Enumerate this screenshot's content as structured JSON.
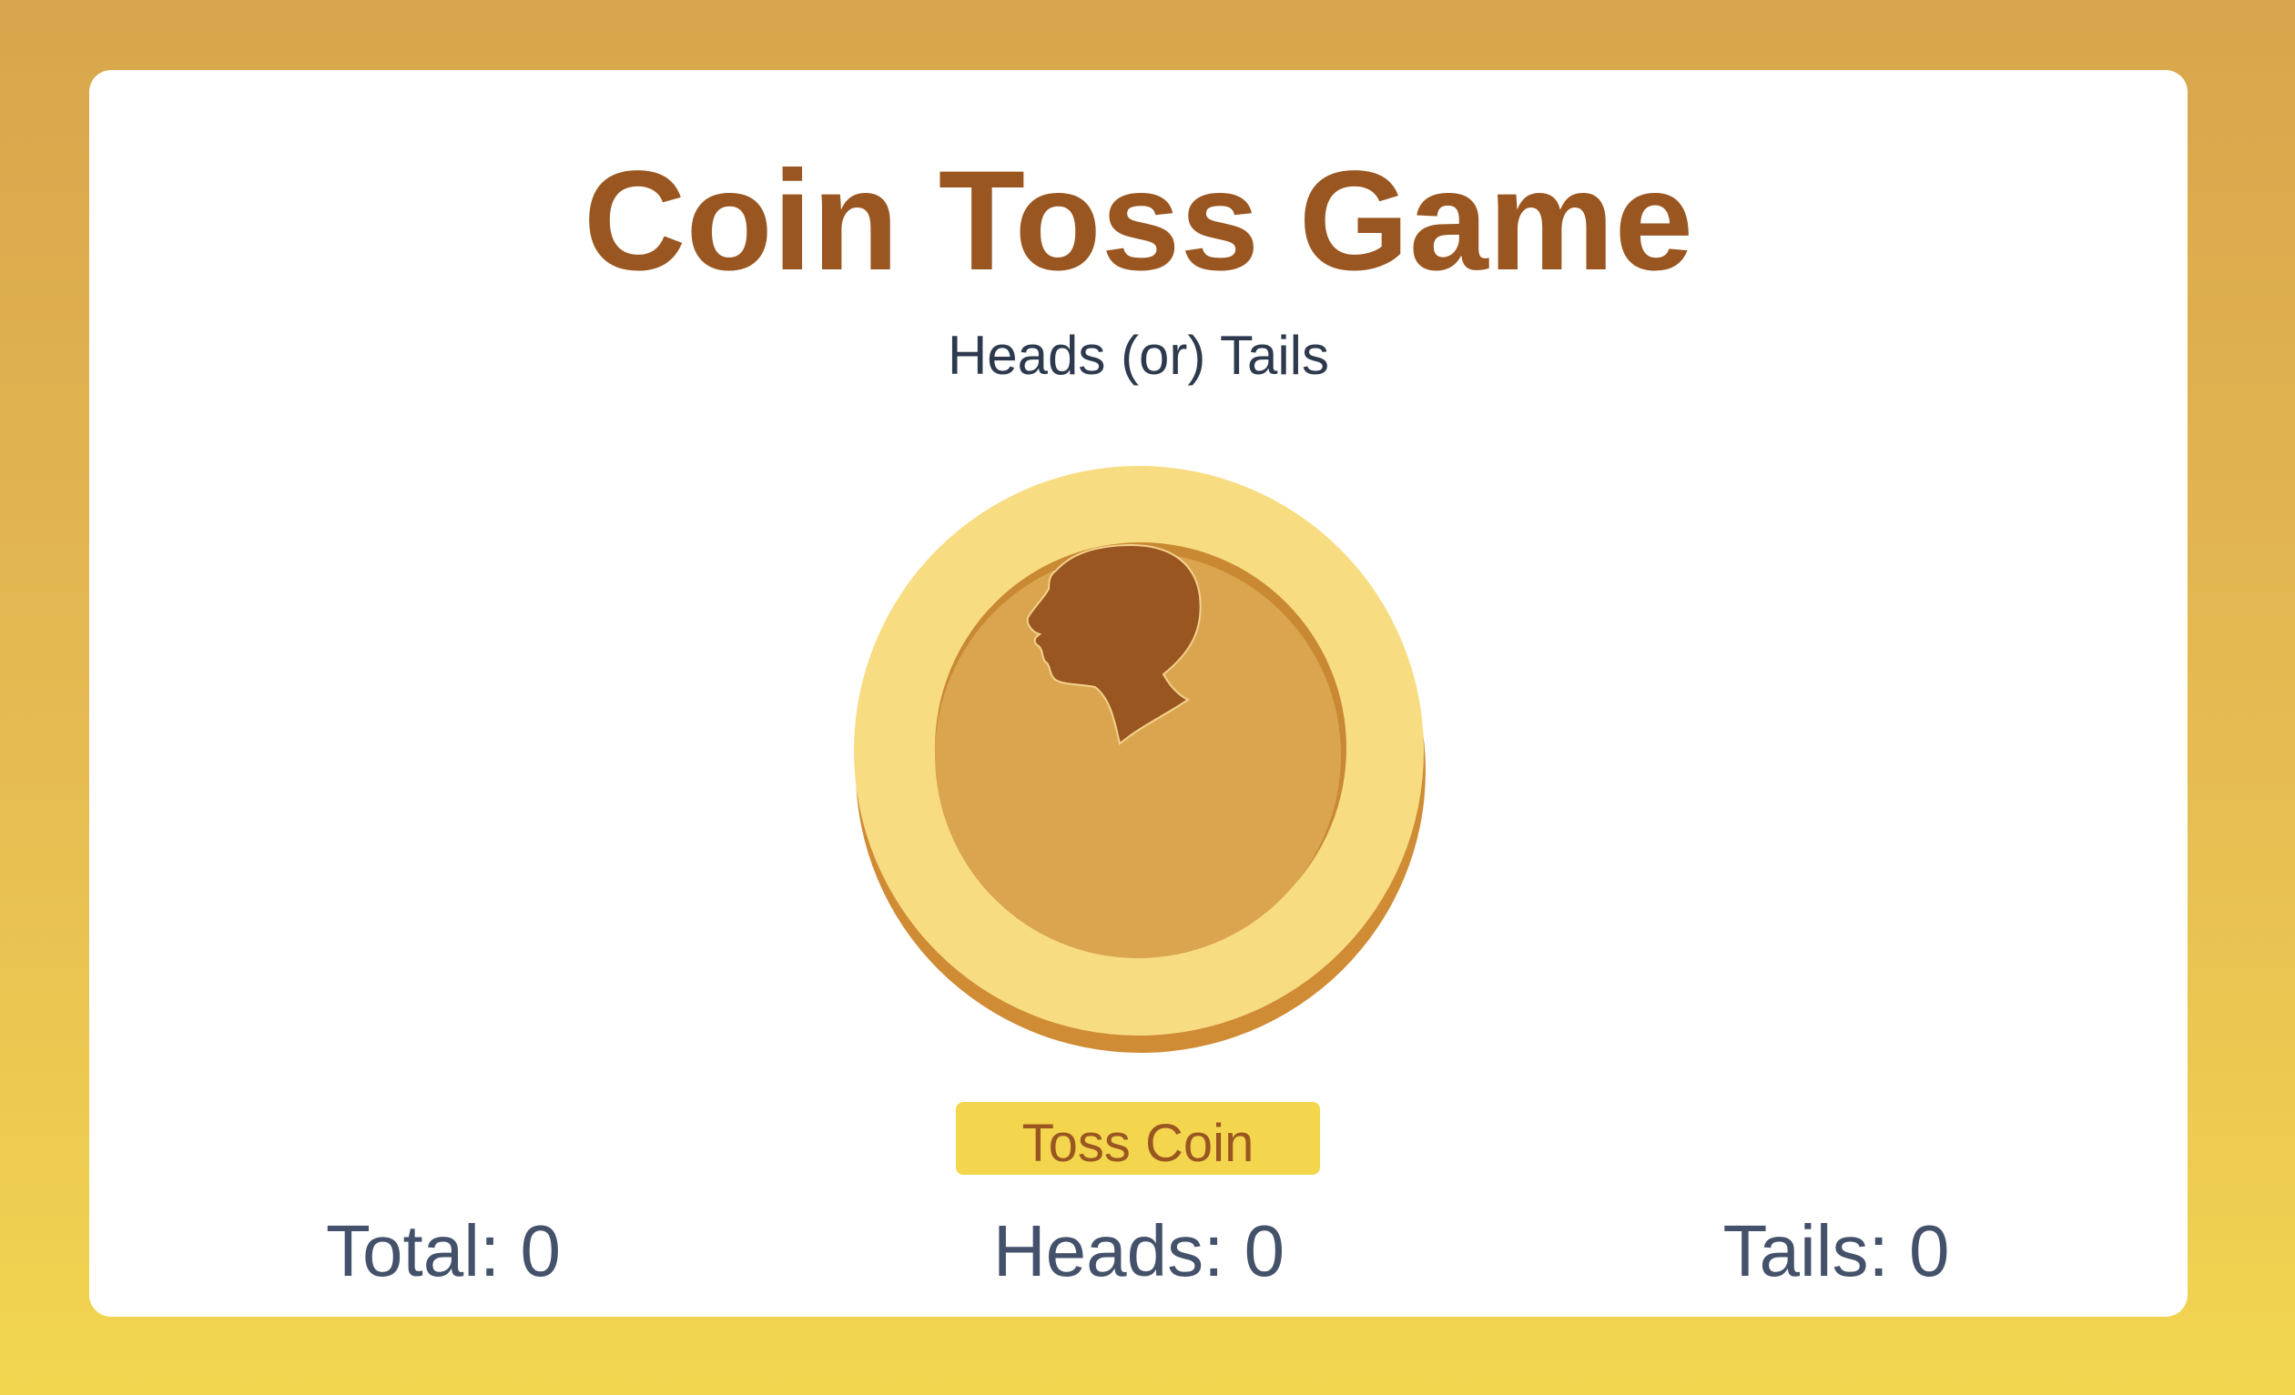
{
  "game": {
    "title": "Coin Toss Game",
    "subtitle": "Heads (or) Tails",
    "coin_icon": "coin-heads-profile-icon",
    "toss_button_label": "Toss Coin"
  },
  "stats": {
    "total": "Total: 0",
    "heads": "Heads: 0",
    "tails": "Tails: 0"
  },
  "colors": {
    "background_top": "#d8a54c",
    "background_bottom": "#f2d650",
    "title": "#9a5620",
    "button_bg": "#f3d64e",
    "button_text": "#9a5620",
    "coin_rim": "#f8dc82",
    "coin_face": "#dba54f",
    "coin_profile": "#9a5620"
  }
}
